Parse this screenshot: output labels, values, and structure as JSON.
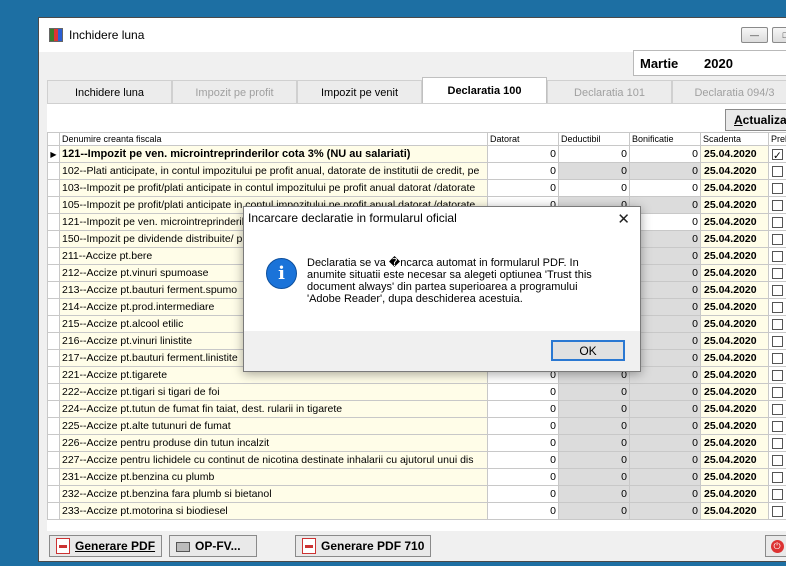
{
  "window": {
    "title": "Inchidere luna",
    "period_month": "Martie",
    "period_year": "2020"
  },
  "tabs": [
    {
      "label": "Inchidere luna",
      "state": "normal"
    },
    {
      "label": "Impozit pe profit",
      "state": "disabled"
    },
    {
      "label": "Impozit pe venit",
      "state": "normal"
    },
    {
      "label": "Declaratia 100",
      "state": "active"
    },
    {
      "label": "Declaratia 101",
      "state": "disabled"
    },
    {
      "label": "Declaratia 094/3",
      "state": "disabled"
    }
  ],
  "toolbar": {
    "update_label_first": "A",
    "update_label_rest": "ctualizare"
  },
  "grid": {
    "columns": [
      "Denumire creanta fiscala",
      "Datorat",
      "Deductibil",
      "Bonificatie",
      "Scadenta",
      "Prelu"
    ],
    "rows": [
      {
        "name": "121--Impozit pe ven. microintreprinderilor cota 3% (NU au salariati)",
        "datorat": "0",
        "deductibil": "0",
        "bonificatie": "0",
        "scadenta": "25.04.2020",
        "checked": true,
        "grey": false
      },
      {
        "name": "102--Plati anticipate, in contul impozitului pe profit anual, datorate de institutii de credit, pe",
        "datorat": "0",
        "deductibil": "0",
        "bonificatie": "0",
        "scadenta": "25.04.2020",
        "checked": false,
        "grey": true
      },
      {
        "name": "103--Impozit pe profit/plati anticipate in contul impozitului pe profit anual datorat /datorate",
        "datorat": "0",
        "deductibil": "0",
        "bonificatie": "0",
        "scadenta": "25.04.2020",
        "checked": false,
        "grey": false
      },
      {
        "name": "105--Impozit pe profit/plati anticipate in contul impozitului pe profit anual datorat /datorate",
        "datorat": "0",
        "deductibil": "0",
        "bonificatie": "0",
        "scadenta": "25.04.2020",
        "checked": false,
        "grey": true
      },
      {
        "name": "121--Impozit pe ven. microintreprinderilor",
        "datorat": "0",
        "deductibil": "0",
        "bonificatie": "0",
        "scadenta": "25.04.2020",
        "checked": false,
        "grey": false
      },
      {
        "name": "150--Impozit pe dividende distribuite/ p",
        "datorat": "0",
        "deductibil": "0",
        "bonificatie": "0",
        "scadenta": "25.04.2020",
        "checked": false,
        "grey": true
      },
      {
        "name": "211--Accize pt.bere",
        "datorat": "0",
        "deductibil": "0",
        "bonificatie": "0",
        "scadenta": "25.04.2020",
        "checked": false,
        "grey": true
      },
      {
        "name": "212--Accize pt.vinuri spumoase",
        "datorat": "0",
        "deductibil": "0",
        "bonificatie": "0",
        "scadenta": "25.04.2020",
        "checked": false,
        "grey": true
      },
      {
        "name": "213--Accize pt.bauturi ferment.spumo",
        "datorat": "0",
        "deductibil": "0",
        "bonificatie": "0",
        "scadenta": "25.04.2020",
        "checked": false,
        "grey": true
      },
      {
        "name": "214--Accize pt.prod.intermediare",
        "datorat": "0",
        "deductibil": "0",
        "bonificatie": "0",
        "scadenta": "25.04.2020",
        "checked": false,
        "grey": true
      },
      {
        "name": "215--Accize pt.alcool etilic",
        "datorat": "0",
        "deductibil": "0",
        "bonificatie": "0",
        "scadenta": "25.04.2020",
        "checked": false,
        "grey": true
      },
      {
        "name": "216--Accize pt.vinuri linistite",
        "datorat": "0",
        "deductibil": "0",
        "bonificatie": "0",
        "scadenta": "25.04.2020",
        "checked": false,
        "grey": true
      },
      {
        "name": "217--Accize pt.bauturi ferment.linistite",
        "datorat": "0",
        "deductibil": "0",
        "bonificatie": "0",
        "scadenta": "25.04.2020",
        "checked": false,
        "grey": true
      },
      {
        "name": "221--Accize pt.tigarete",
        "datorat": "0",
        "deductibil": "0",
        "bonificatie": "0",
        "scadenta": "25.04.2020",
        "checked": false,
        "grey": true
      },
      {
        "name": "222--Accize pt.tigari si tigari de foi",
        "datorat": "0",
        "deductibil": "0",
        "bonificatie": "0",
        "scadenta": "25.04.2020",
        "checked": false,
        "grey": true
      },
      {
        "name": "224--Accize pt.tutun de fumat fin taiat, dest. rularii in tigarete",
        "datorat": "0",
        "deductibil": "0",
        "bonificatie": "0",
        "scadenta": "25.04.2020",
        "checked": false,
        "grey": true
      },
      {
        "name": "225--Accize pt.alte tutunuri de fumat",
        "datorat": "0",
        "deductibil": "0",
        "bonificatie": "0",
        "scadenta": "25.04.2020",
        "checked": false,
        "grey": true
      },
      {
        "name": "226--Accize pentru produse din tutun incalzit",
        "datorat": "0",
        "deductibil": "0",
        "bonificatie": "0",
        "scadenta": "25.04.2020",
        "checked": false,
        "grey": true
      },
      {
        "name": "227--Accize pentru lichidele cu continut de nicotina destinate inhalarii cu ajutorul unui dis",
        "datorat": "0",
        "deductibil": "0",
        "bonificatie": "0",
        "scadenta": "25.04.2020",
        "checked": false,
        "grey": true
      },
      {
        "name": "231--Accize pt.benzina cu plumb",
        "datorat": "0",
        "deductibil": "0",
        "bonificatie": "0",
        "scadenta": "25.04.2020",
        "checked": false,
        "grey": true
      },
      {
        "name": "232--Accize pt.benzina fara plumb si bietanol",
        "datorat": "0",
        "deductibil": "0",
        "bonificatie": "0",
        "scadenta": "25.04.2020",
        "checked": false,
        "grey": true
      },
      {
        "name": "233--Accize pt.motorina si biodiesel",
        "datorat": "0",
        "deductibil": "0",
        "bonificatie": "0",
        "scadenta": "25.04.2020",
        "checked": false,
        "grey": true
      }
    ]
  },
  "bottom": {
    "generate_pdf": "Generare PDF",
    "op_fv": "OP-FV...",
    "generate_pdf_710": "Generare PDF 710"
  },
  "dialog": {
    "title": "Incarcare declaratie in formularul oficial",
    "message": "Declaratia se va �ncarca automat in formularul PDF. In\nanumite situatii este necesar sa alegeti optiunea 'Trust this\ndocument always' din partea superioarea a programului\n'Adobe Reader', dupa deschiderea acestuia.",
    "icon_letter": "i",
    "ok_label": "OK",
    "close_glyph": "✕"
  },
  "colors": {
    "desktop": "#1d6fa3",
    "name_cell_bg": "#fffde8",
    "grey_cell_bg": "#dcdcdc",
    "info_icon": "#1a73d9",
    "ok_border": "#2a78d2"
  },
  "icons": {
    "app": "app-chart-icon",
    "pdf": "pdf-file-icon",
    "print": "printer-icon",
    "exit": "power-icon",
    "info": "information-icon",
    "row_pointer": "row-pointer-icon"
  }
}
